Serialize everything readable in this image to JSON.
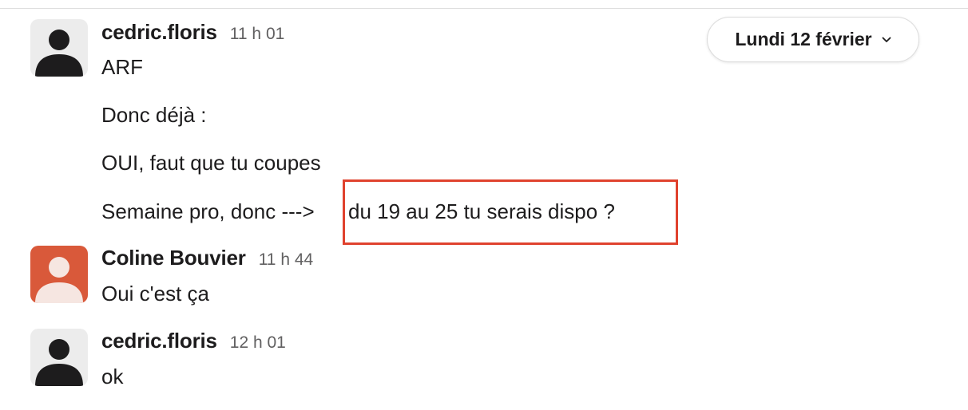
{
  "date_divider": {
    "label": "Lundi 12 février",
    "icon": "chevron-down-icon"
  },
  "messages": [
    {
      "author": "cedric.floris",
      "time": "11 h 01",
      "avatar": "generic-user-avatar",
      "lines": [
        "ARF",
        "Donc déjà :",
        "OUI, faut que tu coupes",
        "Semaine pro, donc --->",
        "du 19 au 25 tu serais dispo ?"
      ]
    },
    {
      "author": "Coline Bouvier",
      "time": "11 h 44",
      "avatar": "orange-user-avatar",
      "lines": [
        "Oui c'est ça"
      ]
    },
    {
      "author": "cedric.floris",
      "time": "12 h 01",
      "avatar": "generic-user-avatar",
      "lines": [
        "ok"
      ]
    }
  ],
  "colors": {
    "highlight_border": "#e0422e",
    "orange_avatar": "#d9593a",
    "text": "#1d1c1d",
    "timestamp": "#616061"
  }
}
